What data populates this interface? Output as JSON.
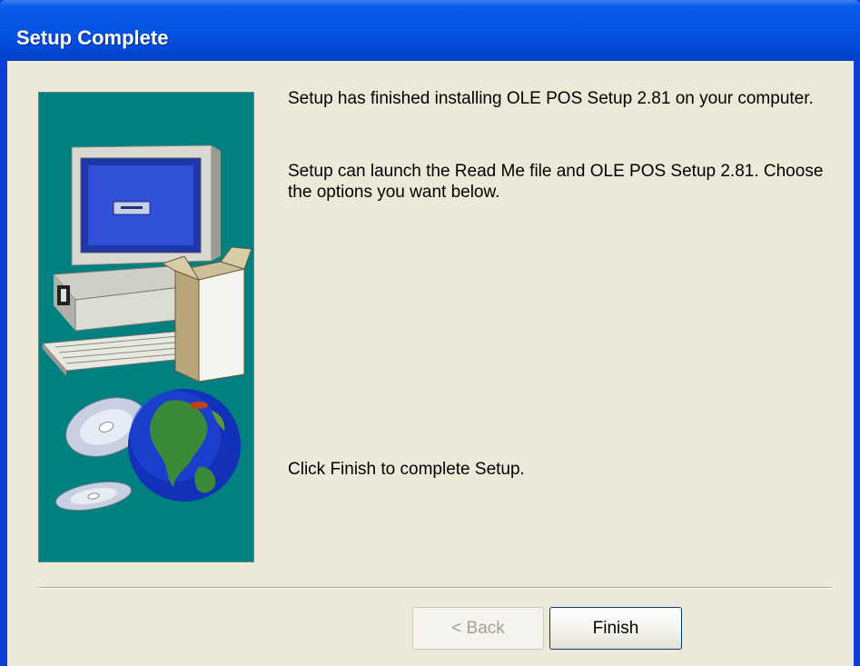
{
  "window": {
    "title": "Setup Complete"
  },
  "content": {
    "message_finished": "Setup has finished installing OLE POS Setup 2.81 on your computer.",
    "message_options": "Setup can launch the Read Me file and OLE POS Setup 2.81. Choose the options you want below.",
    "message_click_finish": "Click Finish to complete Setup."
  },
  "buttons": {
    "back_label": "< Back",
    "back_enabled": false,
    "finish_label": "Finish"
  },
  "illustration": {
    "icons": [
      "computer-icon",
      "software-box-icon",
      "cd-icon",
      "globe-icon"
    ]
  },
  "colors": {
    "titlebar": "#0454e2",
    "panel_bg": "#ece9d8",
    "side_panel": "#008080"
  }
}
